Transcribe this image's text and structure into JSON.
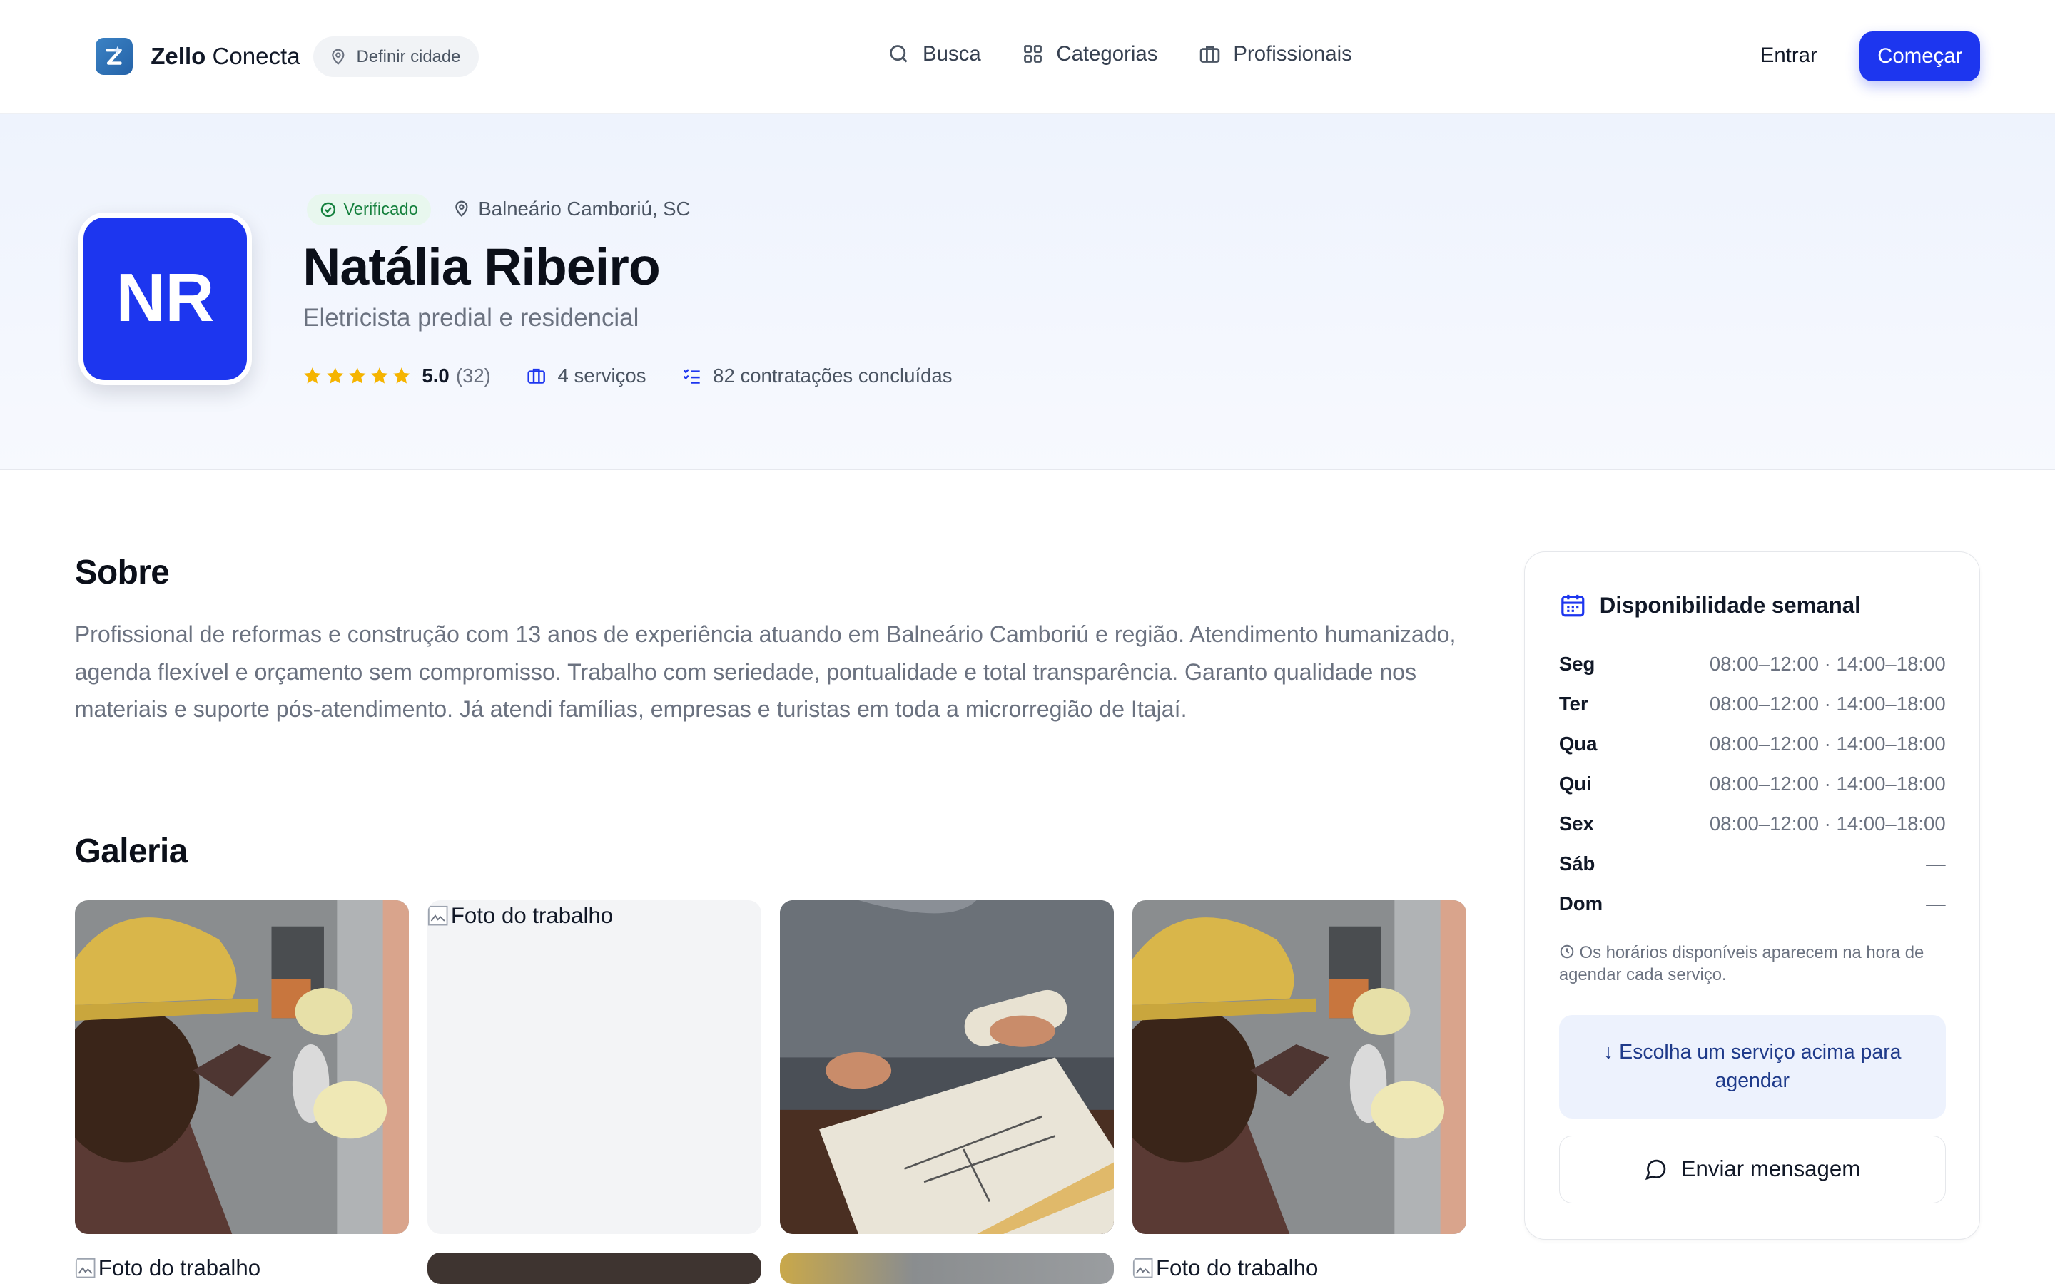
{
  "header": {
    "brand_bold": "Zello",
    "brand_rest": "Conecta",
    "city_label": "Definir cidade",
    "nav": [
      "Busca",
      "Categorias",
      "Profissionais"
    ],
    "login": "Entrar",
    "cta": "Começar"
  },
  "profile": {
    "initials": "NR",
    "verified": "Verificado",
    "location": "Balneário Camboriú, SC",
    "name": "Natália Ribeiro",
    "profession": "Eletricista predial e residencial",
    "rating": "5.0",
    "reviews": "(32)",
    "stars": 5,
    "services": "4 serviços",
    "hires": "82 contratações concluídas"
  },
  "about": {
    "title": "Sobre",
    "text": "Profissional de reformas e construção com 13 anos de experiência atuando em Balneário Camboriú e região. Atendimento humanizado, agenda flexível e orçamento sem compromisso. Trabalho com seriedade, pontualidade e total transparência. Garanto qualidade nos materiais e suporte pós-atendimento. Já atendi famílias, empresas e turistas em toda a microrregião de Itajaí."
  },
  "gallery": {
    "title": "Galeria",
    "broken_alt": "Foto do trabalho"
  },
  "availability": {
    "title": "Disponibilidade semanal",
    "rows": [
      {
        "day": "Seg",
        "hours": "08:00–12:00 · 14:00–18:00"
      },
      {
        "day": "Ter",
        "hours": "08:00–12:00 · 14:00–18:00"
      },
      {
        "day": "Qua",
        "hours": "08:00–12:00 · 14:00–18:00"
      },
      {
        "day": "Qui",
        "hours": "08:00–12:00 · 14:00–18:00"
      },
      {
        "day": "Sex",
        "hours": "08:00–12:00 · 14:00–18:00"
      },
      {
        "day": "Sáb",
        "hours": "—"
      },
      {
        "day": "Dom",
        "hours": "—"
      }
    ],
    "note": "Os horários disponíveis aparecem na hora de agendar cada serviço.",
    "choose": "↓ Escolha um serviço acima para agendar",
    "message_button": "Enviar mensagem"
  },
  "colors": {
    "primary": "#1d36ef",
    "star": "#f5b400",
    "verified_bg": "#e8f7ee",
    "verified_text": "#15803d"
  }
}
